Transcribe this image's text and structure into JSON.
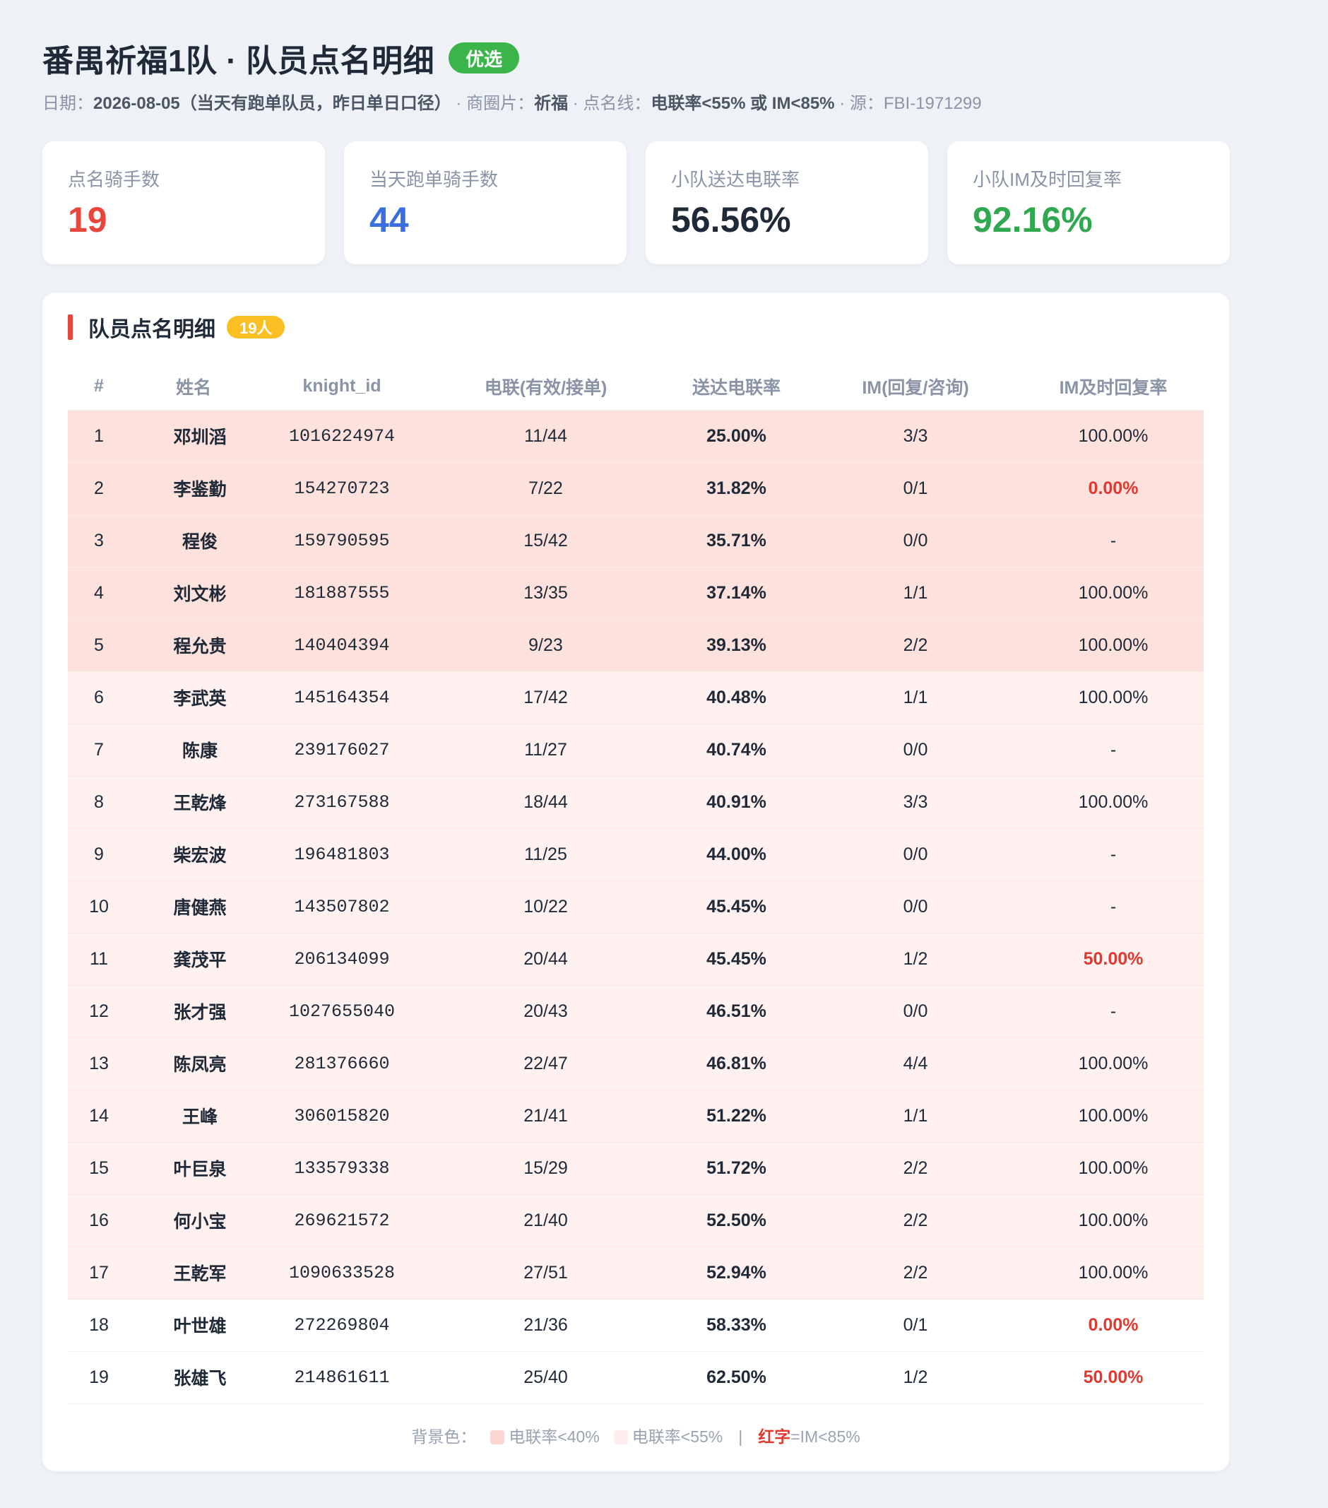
{
  "header": {
    "title": "番禺祈福1队 · 队员点名明细",
    "badge": "优选",
    "date_label": "日期：",
    "date_value": "2026-08-05（当天有跑单队员，昨日单日口径）",
    "area_label": " · 商圈片：",
    "area_value": "祈福",
    "line_label": " · 点名线：",
    "line_value": "电联率<55% 或 IM<85%",
    "source_label": " · 源：FBI-1971299"
  },
  "cards": [
    {
      "label": "点名骑手数",
      "value": "19",
      "color": "#e8453c"
    },
    {
      "label": "当天跑单骑手数",
      "value": "44",
      "color": "#3b6fe0"
    },
    {
      "label": "小队送达电联率",
      "value": "56.56%",
      "color": "#1f2937"
    },
    {
      "label": "小队IM及时回复率",
      "value": "92.16%",
      "color": "#2fa84f"
    }
  ],
  "panel": {
    "title": "队员点名明细",
    "badge": "19人"
  },
  "table": {
    "headers": [
      "#",
      "姓名",
      "knight_id",
      "电联(有效/接单)",
      "送达电联率",
      "IM(回复/咨询)",
      "IM及时回复率"
    ],
    "rows": [
      {
        "no": "1",
        "name": "邓圳滔",
        "kid": "1016224974",
        "call": "11/44",
        "rate": "25.00%",
        "im": "3/3",
        "imr": "100.00%",
        "sev": "high",
        "warn": false
      },
      {
        "no": "2",
        "name": "李鉴勤",
        "kid": "154270723",
        "call": "7/22",
        "rate": "31.82%",
        "im": "0/1",
        "imr": "0.00%",
        "sev": "high",
        "warn": true
      },
      {
        "no": "3",
        "name": "程俊",
        "kid": "159790595",
        "call": "15/42",
        "rate": "35.71%",
        "im": "0/0",
        "imr": "-",
        "sev": "high",
        "warn": false
      },
      {
        "no": "4",
        "name": "刘文彬",
        "kid": "181887555",
        "call": "13/35",
        "rate": "37.14%",
        "im": "1/1",
        "imr": "100.00%",
        "sev": "high",
        "warn": false
      },
      {
        "no": "5",
        "name": "程允贵",
        "kid": "140404394",
        "call": "9/23",
        "rate": "39.13%",
        "im": "2/2",
        "imr": "100.00%",
        "sev": "high",
        "warn": false
      },
      {
        "no": "6",
        "name": "李武英",
        "kid": "145164354",
        "call": "17/42",
        "rate": "40.48%",
        "im": "1/1",
        "imr": "100.00%",
        "sev": "mid",
        "warn": false
      },
      {
        "no": "7",
        "name": "陈康",
        "kid": "239176027",
        "call": "11/27",
        "rate": "40.74%",
        "im": "0/0",
        "imr": "-",
        "sev": "mid",
        "warn": false
      },
      {
        "no": "8",
        "name": "王乾烽",
        "kid": "273167588",
        "call": "18/44",
        "rate": "40.91%",
        "im": "3/3",
        "imr": "100.00%",
        "sev": "mid",
        "warn": false
      },
      {
        "no": "9",
        "name": "柴宏波",
        "kid": "196481803",
        "call": "11/25",
        "rate": "44.00%",
        "im": "0/0",
        "imr": "-",
        "sev": "mid",
        "warn": false
      },
      {
        "no": "10",
        "name": "唐健燕",
        "kid": "143507802",
        "call": "10/22",
        "rate": "45.45%",
        "im": "0/0",
        "imr": "-",
        "sev": "mid",
        "warn": false
      },
      {
        "no": "11",
        "name": "龚茂平",
        "kid": "206134099",
        "call": "20/44",
        "rate": "45.45%",
        "im": "1/2",
        "imr": "50.00%",
        "sev": "mid",
        "warn": true
      },
      {
        "no": "12",
        "name": "张才强",
        "kid": "1027655040",
        "call": "20/43",
        "rate": "46.51%",
        "im": "0/0",
        "imr": "-",
        "sev": "mid",
        "warn": false
      },
      {
        "no": "13",
        "name": "陈凤亮",
        "kid": "281376660",
        "call": "22/47",
        "rate": "46.81%",
        "im": "4/4",
        "imr": "100.00%",
        "sev": "mid",
        "warn": false
      },
      {
        "no": "14",
        "name": "王峰",
        "kid": "306015820",
        "call": "21/41",
        "rate": "51.22%",
        "im": "1/1",
        "imr": "100.00%",
        "sev": "mid",
        "warn": false
      },
      {
        "no": "15",
        "name": "叶巨泉",
        "kid": "133579338",
        "call": "15/29",
        "rate": "51.72%",
        "im": "2/2",
        "imr": "100.00%",
        "sev": "mid",
        "warn": false
      },
      {
        "no": "16",
        "name": "何小宝",
        "kid": "269621572",
        "call": "21/40",
        "rate": "52.50%",
        "im": "2/2",
        "imr": "100.00%",
        "sev": "mid",
        "warn": false
      },
      {
        "no": "17",
        "name": "王乾军",
        "kid": "1090633528",
        "call": "27/51",
        "rate": "52.94%",
        "im": "2/2",
        "imr": "100.00%",
        "sev": "mid",
        "warn": false
      },
      {
        "no": "18",
        "name": "叶世雄",
        "kid": "272269804",
        "call": "21/36",
        "rate": "58.33%",
        "im": "0/1",
        "imr": "0.00%",
        "sev": "none",
        "warn": true
      },
      {
        "no": "19",
        "name": "张雄飞",
        "kid": "214861611",
        "call": "25/40",
        "rate": "62.50%",
        "im": "1/2",
        "imr": "50.00%",
        "sev": "none",
        "warn": true
      }
    ]
  },
  "legend": {
    "prefix": "背景色：",
    "high": "电联率<40%",
    "mid": "电联率<55%",
    "sep": "|",
    "red_word": "红字",
    "red_rule": "=IM<85%"
  }
}
